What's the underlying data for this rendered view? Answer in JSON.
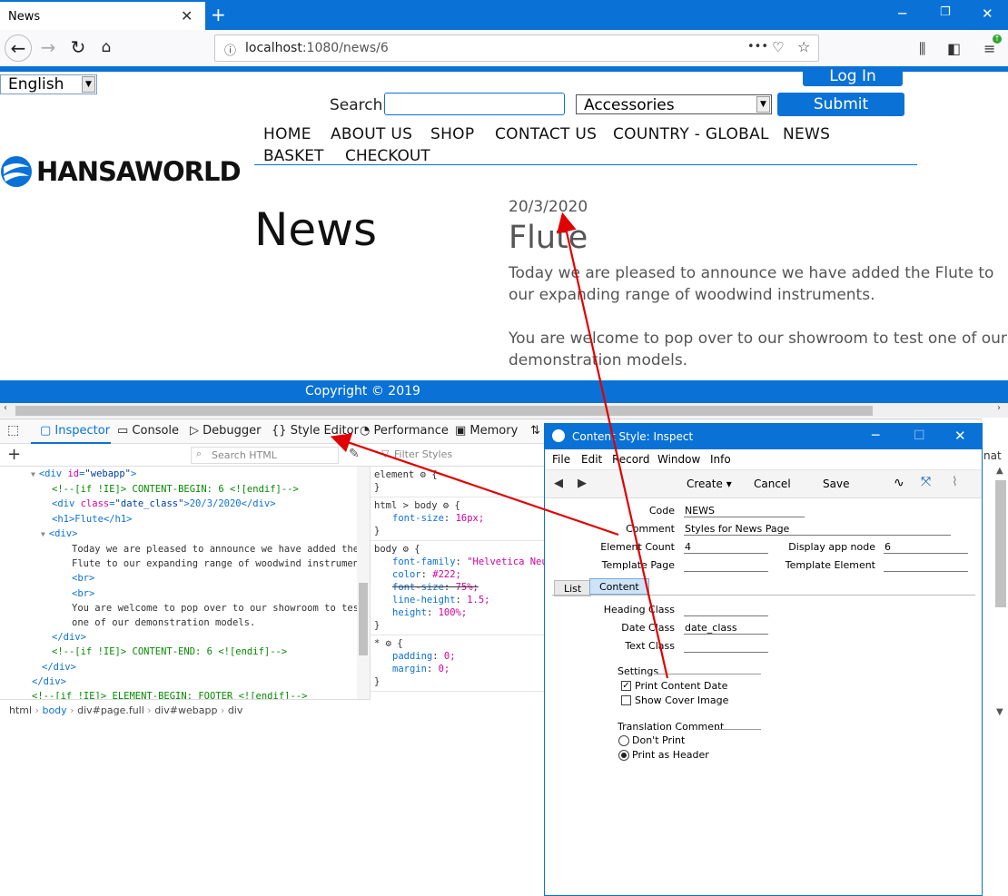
{
  "browser": {
    "tab_title": "News",
    "url_host": "localhost",
    "url_path": ":1080/news/6",
    "info_icon": "info-icon",
    "more_label": "•••"
  },
  "page": {
    "language": "English",
    "login_label": "Log In",
    "search_label": "Search",
    "search_value": "",
    "category": "Accessories",
    "submit_label": "Submit",
    "menu_row1": [
      "HOME",
      "ABOUT US",
      "SHOP",
      "CONTACT US",
      "COUNTRY - GLOBAL",
      "NEWS"
    ],
    "menu_row2": [
      "BASKET",
      "CHECKOUT"
    ],
    "logo_text": "HANSAWORLD",
    "heading": "News",
    "article_date": "20/3/2020",
    "article_title": "Flute",
    "article_p1": "Today we are pleased to announce we have added the Flute to our expanding range of woodwind instruments.",
    "article_p2": "You are welcome to pop over to our showroom to test one of our demonstration models.",
    "footer": "Copyright © 2019",
    "colors": {
      "accent": "#0a72d6"
    }
  },
  "devtools": {
    "tabs": [
      "Inspector",
      "Console",
      "Debugger",
      "Style Editor",
      "Performance",
      "Memory"
    ],
    "search_html_placeholder": "Search HTML",
    "filter_styles_placeholder": "Filter Styles",
    "markup_lines": [
      {
        "indent": 0,
        "text": "<div id=\"webapp\">"
      },
      {
        "indent": 1,
        "text": "<!--[if !IE]> CONTENT-BEGIN: 6 <![endif]-->"
      },
      {
        "indent": 1,
        "text": "<div class=\"date_class\">20/3/2020</div>"
      },
      {
        "indent": 1,
        "text": "<h1>Flute</h1>"
      },
      {
        "indent": 1,
        "text": "<div>"
      },
      {
        "indent": 2,
        "text": "Today we are pleased to announce we have added the"
      },
      {
        "indent": 2,
        "text": "Flute to our expanding range of woodwind instruments."
      },
      {
        "indent": 2,
        "text": "<br>"
      },
      {
        "indent": 2,
        "text": "<br>"
      },
      {
        "indent": 2,
        "text": "You are welcome to pop over to our showroom to test"
      },
      {
        "indent": 2,
        "text": "one of our demonstration models."
      },
      {
        "indent": 1,
        "text": "</div>"
      },
      {
        "indent": 1,
        "text": "<!--[if !IE]> CONTENT-END: 6 <![endif]-->"
      },
      {
        "indent": 0,
        "text": "</div>"
      },
      {
        "indent": -1,
        "text": "</div>"
      },
      {
        "indent": -1,
        "text": "<!--[if !IE]> ELEMENT-BEGIN: FOOTER <![endif]-->"
      }
    ],
    "breadcrumbs": [
      "html",
      "body",
      "div#page.full",
      "div#webapp",
      "div"
    ],
    "rules": [
      {
        "selector": "element",
        "props": []
      },
      {
        "selector": "html > body",
        "props": [
          {
            "name": "font-size",
            "value": "16px;",
            "strike": false
          }
        ]
      },
      {
        "selector": "body",
        "props": [
          {
            "name": "font-family",
            "value": "\"Helvetica Neue\", Helvetica, sans-serif;",
            "strike": false
          },
          {
            "name": "color",
            "value": "#222;",
            "strike": false
          },
          {
            "name": "font-size",
            "value": "75%;",
            "strike": true
          },
          {
            "name": "line-height",
            "value": "1.5;",
            "strike": false
          },
          {
            "name": "height",
            "value": "100%;",
            "strike": false
          }
        ]
      },
      {
        "selector": "*",
        "props": [
          {
            "name": "padding",
            "value": "0;",
            "strike": false
          },
          {
            "name": "margin",
            "value": "0;",
            "strike": false
          }
        ]
      }
    ]
  },
  "content_style": {
    "title": "Content Style: Inspect",
    "menus": [
      "File",
      "Edit",
      "Record",
      "Window",
      "Info"
    ],
    "toolbar": {
      "create": "Create",
      "cancel": "Cancel",
      "save": "Save"
    },
    "fields": {
      "code_label": "Code",
      "code": "NEWS",
      "comment_label": "Comment",
      "comment": "Styles for News Page",
      "element_count_label": "Element Count",
      "element_count": "4",
      "display_app_node_label": "Display app node",
      "display_app_node": "6",
      "template_page_label": "Template Page",
      "template_page": "",
      "template_element_label": "Template Element",
      "template_element": ""
    },
    "tabs": [
      "List",
      "Content"
    ],
    "content": {
      "heading_class_label": "Heading Class",
      "heading_class": "",
      "date_class_label": "Date Class",
      "date_class": "date_class",
      "text_class_label": "Text Class",
      "text_class": "",
      "settings_label": "Settings",
      "print_content_date": "Print Content Date",
      "show_cover_image": "Show Cover Image",
      "translation_comment_label": "Translation Comment",
      "dont_print": "Don't Print",
      "print_as_header": "Print as Header"
    }
  }
}
